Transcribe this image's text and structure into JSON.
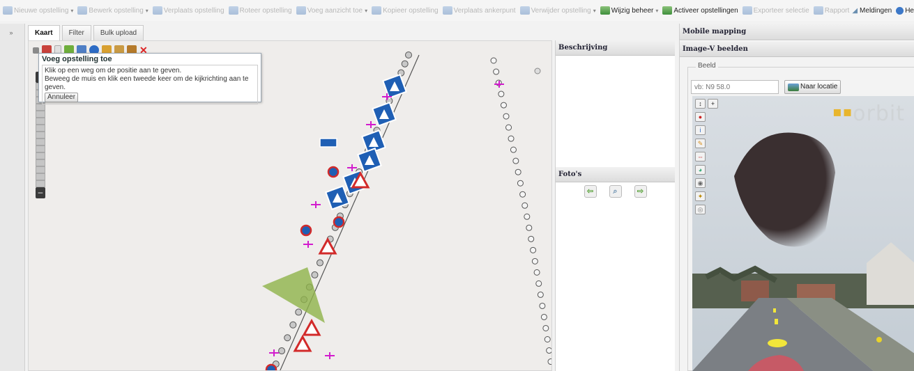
{
  "toolbar": {
    "items": [
      {
        "label": "Nieuwe opstelling",
        "dropdown": true,
        "active": false
      },
      {
        "label": "Bewerk opstelling",
        "dropdown": true,
        "active": false
      },
      {
        "label": "Verplaats opstelling",
        "dropdown": false,
        "active": false
      },
      {
        "label": "Roteer opstelling",
        "dropdown": false,
        "active": false
      },
      {
        "label": "Voeg aanzicht toe",
        "dropdown": true,
        "active": false
      },
      {
        "label": "Kopieer opstelling",
        "dropdown": false,
        "active": false
      },
      {
        "label": "Verplaats ankerpunt",
        "dropdown": false,
        "active": false
      },
      {
        "label": "Verwijder opstelling",
        "dropdown": true,
        "active": false
      },
      {
        "label": "Wijzig beheer",
        "dropdown": true,
        "active": true
      },
      {
        "label": "Activeer opstellingen",
        "dropdown": false,
        "active": true
      },
      {
        "label": "Exporteer selectie",
        "dropdown": false,
        "active": false
      },
      {
        "label": "Rapport",
        "dropdown": false,
        "active": false
      }
    ],
    "meldingen_label": "Meldingen",
    "help_label": "He"
  },
  "collapse_label": "»",
  "tabs": [
    {
      "label": "Kaart",
      "active": true
    },
    {
      "label": "Filter",
      "active": false
    },
    {
      "label": "Bulk upload",
      "active": false
    }
  ],
  "popup": {
    "title": "Voeg opstelling toe",
    "line1": "Klik op een weg om de positie aan te geven.",
    "line2": "Beweeg de muis en klik een tweede keer om de kijkrichting aan te geven.",
    "cancel_label": "Annuleer"
  },
  "zoom": {
    "plus": "+",
    "minus": "–"
  },
  "beschrijving": {
    "title": "Beschrijving"
  },
  "fotos": {
    "title": "Foto's"
  },
  "mobile_mapping": {
    "title": "Mobile mapping",
    "image_v_title": "Image-V beelden",
    "beeld_legend": "Beeld",
    "search_placeholder": "vb: N9 58.0",
    "naar_locatie_label": "Naar locatie",
    "brand": "orbit",
    "brand_dots": "▪▪"
  },
  "colors": {
    "accent_green": "#3f8f3c",
    "map_bg": "#efedeb",
    "sign_blue": "#1f5fb4",
    "warning_red": "#d22a2a",
    "view_cone": "#8fb34a",
    "marker_magenta": "#d21ccd"
  }
}
